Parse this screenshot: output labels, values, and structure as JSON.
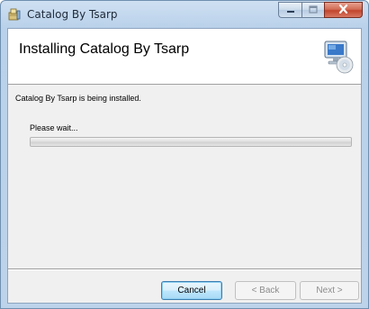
{
  "window": {
    "title": "Catalog By Tsarp",
    "app_icon": "installer-icon"
  },
  "caption": {
    "minimize_icon": "minimize-icon",
    "maximize_icon": "maximize-icon",
    "close_icon": "close-icon"
  },
  "banner": {
    "heading": "Installing Catalog By Tsarp",
    "icon": "computer-cd-icon"
  },
  "body": {
    "status": "Catalog By Tsarp is being installed.",
    "wait_label": "Please wait...",
    "progress_fraction": 0
  },
  "buttons": {
    "cancel": "Cancel",
    "back": "< Back",
    "next": "Next >"
  },
  "colors": {
    "accent": "#3c7fb1",
    "close_button": "#c2452c",
    "progress_fill": "#3bbf3b"
  }
}
